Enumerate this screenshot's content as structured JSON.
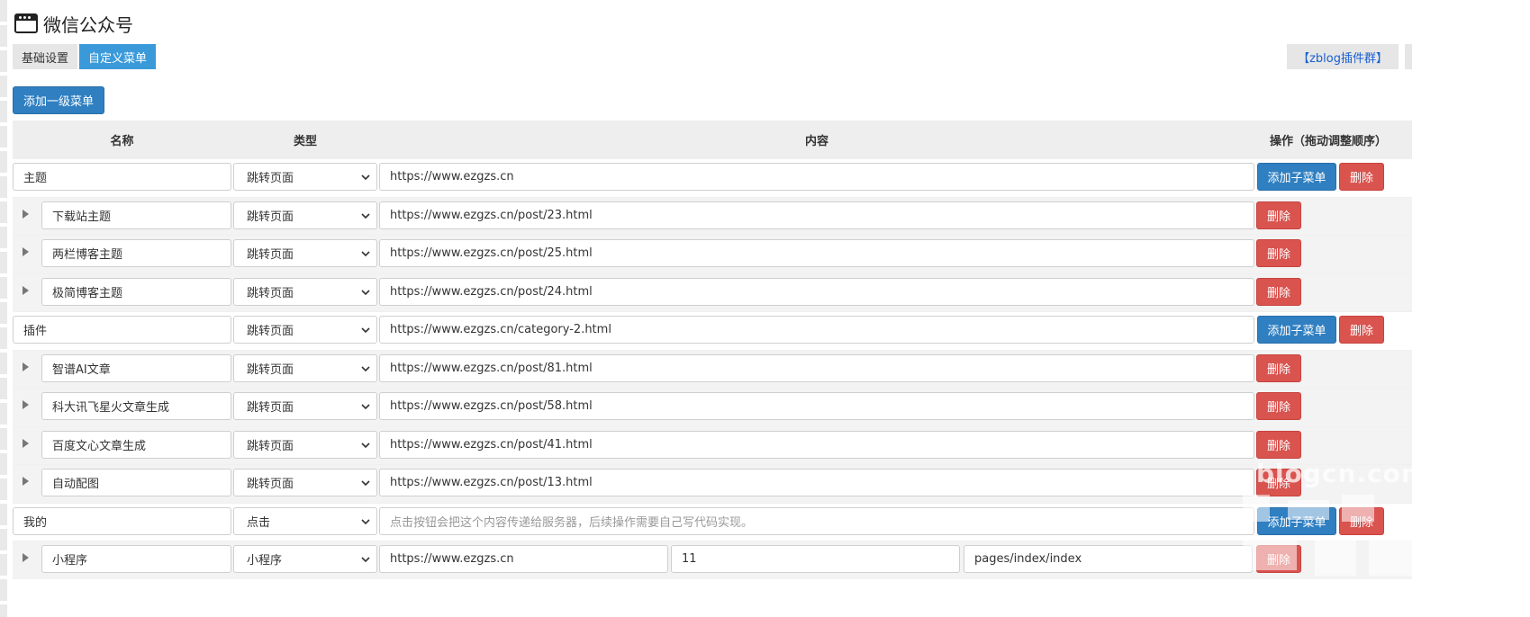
{
  "page": {
    "title": "微信公众号"
  },
  "tabs": [
    {
      "label": "基础设置",
      "active": false
    },
    {
      "label": "自定义菜单",
      "active": true
    }
  ],
  "plugin_link": "【zblog插件群】",
  "add_top_button": "添加一级菜单",
  "table": {
    "headers": {
      "name": "名称",
      "type": "类型",
      "content": "内容",
      "ops": "操作（拖动调整顺序）"
    },
    "rows": [
      {
        "level": "parent",
        "name": "主题",
        "type": "跳转页面",
        "content": "https://www.ezgzs.cn"
      },
      {
        "level": "child",
        "name": "下载站主题",
        "type": "跳转页面",
        "content": "https://www.ezgzs.cn/post/23.html"
      },
      {
        "level": "child",
        "name": "两栏博客主题",
        "type": "跳转页面",
        "content": "https://www.ezgzs.cn/post/25.html"
      },
      {
        "level": "child",
        "name": "极简博客主题",
        "type": "跳转页面",
        "content": "https://www.ezgzs.cn/post/24.html"
      },
      {
        "level": "parent",
        "name": "插件",
        "type": "跳转页面",
        "content": "https://www.ezgzs.cn/category-2.html"
      },
      {
        "level": "child",
        "name": "智谱AI文章",
        "type": "跳转页面",
        "content": "https://www.ezgzs.cn/post/81.html"
      },
      {
        "level": "child",
        "name": "科大讯飞星火文章生成",
        "type": "跳转页面",
        "content": "https://www.ezgzs.cn/post/58.html"
      },
      {
        "level": "child",
        "name": "百度文心文章生成",
        "type": "跳转页面",
        "content": "https://www.ezgzs.cn/post/41.html"
      },
      {
        "level": "child",
        "name": "自动配图",
        "type": "跳转页面",
        "content": "https://www.ezgzs.cn/post/13.html"
      },
      {
        "level": "parent",
        "name": "我的",
        "type": "点击",
        "content_placeholder": "点击按钮会把这个内容传递给服务器，后续操作需要自己写代码实现。"
      },
      {
        "level": "child",
        "name": "小程序",
        "type": "小程序",
        "content": "https://www.ezgzs.cn",
        "content2": "11",
        "content3": "pages/index/index"
      }
    ],
    "add_sub_label": "添加子菜单",
    "delete_label": "删除"
  },
  "watermark": "blogcn.com",
  "colors": {
    "primary": "#2f7fc1",
    "danger": "#d9534f",
    "tab_active": "#3a9ad9",
    "header_bg": "#eeeeee"
  },
  "icons": {
    "title": "window-icon",
    "expand": "caret-right-icon",
    "select": "chevron-down-icon"
  }
}
